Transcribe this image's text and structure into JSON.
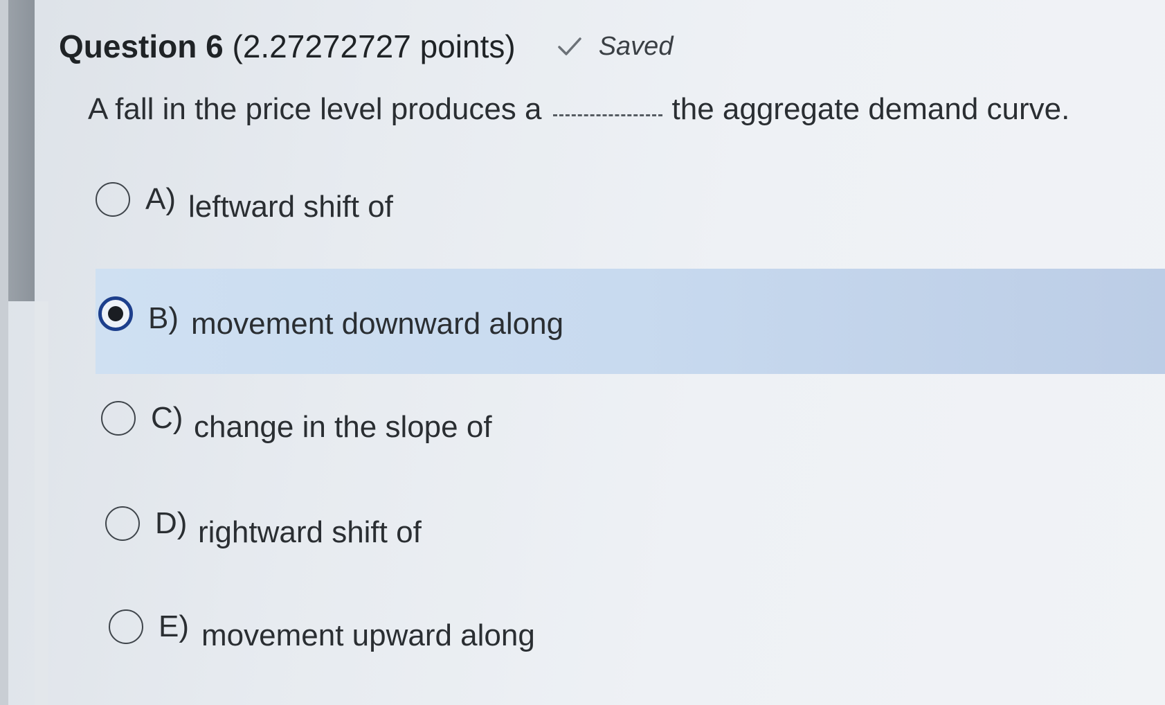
{
  "question": {
    "number_label": "Question 6",
    "points_label": "(2.27272727 points)",
    "status": {
      "icon": "checkmark-icon",
      "label": "Saved"
    },
    "prompt_before": "A fall in the price level produces a",
    "prompt_after": "the aggregate demand curve."
  },
  "options": [
    {
      "letter": "A)",
      "text": "leftward shift of",
      "selected": false
    },
    {
      "letter": "B)",
      "text": "movement downward along",
      "selected": true
    },
    {
      "letter": "C)",
      "text": "change in the slope of",
      "selected": false
    },
    {
      "letter": "D)",
      "text": "rightward shift of",
      "selected": false
    },
    {
      "letter": "E)",
      "text": "movement upward along",
      "selected": false
    }
  ],
  "colors": {
    "selected_highlight": "#c8daef",
    "radio_checked_border": "#1d3f8c"
  }
}
